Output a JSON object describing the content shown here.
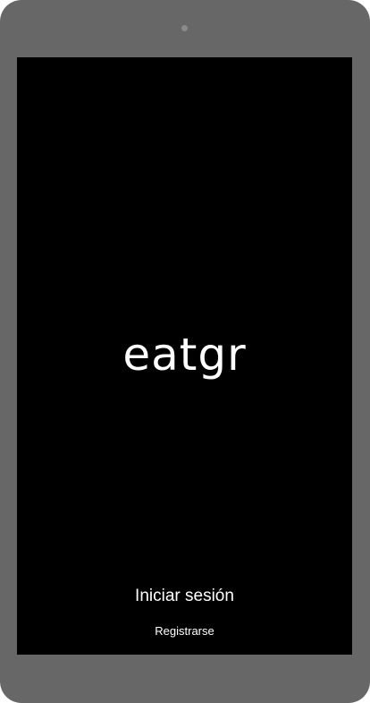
{
  "device": {
    "frame_color": "#676767",
    "screen_color": "#000000"
  },
  "app": {
    "logo_text": "eatgr"
  },
  "actions": {
    "login_label": "Iniciar sesión",
    "register_label": "Registrarse"
  },
  "colors": {
    "text": "#ffffff"
  }
}
